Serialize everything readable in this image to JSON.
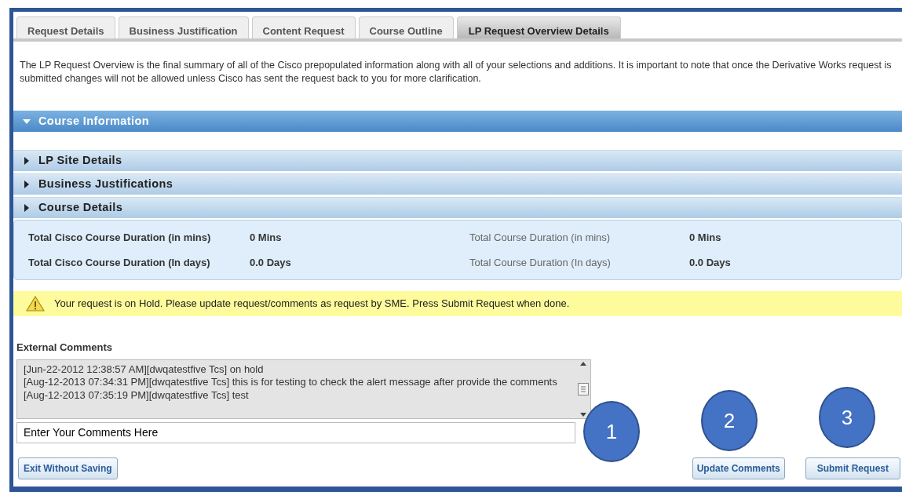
{
  "tabs": [
    {
      "label": "Request Details",
      "selected": false
    },
    {
      "label": "Business Justification",
      "selected": false
    },
    {
      "label": "Content Request",
      "selected": false
    },
    {
      "label": "Course Outline",
      "selected": false
    },
    {
      "label": "LP Request Overview Details",
      "selected": true
    }
  ],
  "intro": "The LP Request Overview is the final summary of all of the Cisco prepopulated information along with all of your selections and additions. It is important to note that once the Derivative Works request is submitted changes will not be allowed unless Cisco has sent the request back to you for more clarification.",
  "sections": [
    {
      "title": "Course Information",
      "expanded": true
    },
    {
      "title": "LP Site Details",
      "expanded": false
    },
    {
      "title": "Business Justifications",
      "expanded": false
    },
    {
      "title": "Course Details",
      "expanded": false
    }
  ],
  "durations": [
    {
      "label": "Total Cisco Course Duration (in mins)",
      "value": "0 Mins",
      "label_bold": true
    },
    {
      "label": "Total Course Duration (in mins)",
      "value": "0 Mins",
      "label_bold": false
    },
    {
      "label": "Total Cisco Course Duration (In days)",
      "value": "0.0 Days",
      "label_bold": true
    },
    {
      "label": "Total Course Duration (In days)",
      "value": "0.0 Days",
      "label_bold": false
    }
  ],
  "alert": "Your request is on Hold. Please update request/comments as request by SME. Press Submit Request when done.",
  "comments": {
    "label": "External Comments",
    "entries": [
      "[Jun-22-2012  12:38:57  AM][dwqatestfive Tcs]  on hold",
      "[Aug-12-2013  07:34:31  PM][dwqatestfive Tcs]  this is for testing to check the alert message after provide the comments",
      "[Aug-12-2013  07:35:19  PM][dwqatestfive Tcs]  test"
    ],
    "input_value": "Enter Your Comments Here"
  },
  "buttons": {
    "exit": "Exit Without Saving",
    "update": "Update Comments",
    "submit": "Submit Request"
  },
  "callouts": [
    "1",
    "2",
    "3"
  ]
}
